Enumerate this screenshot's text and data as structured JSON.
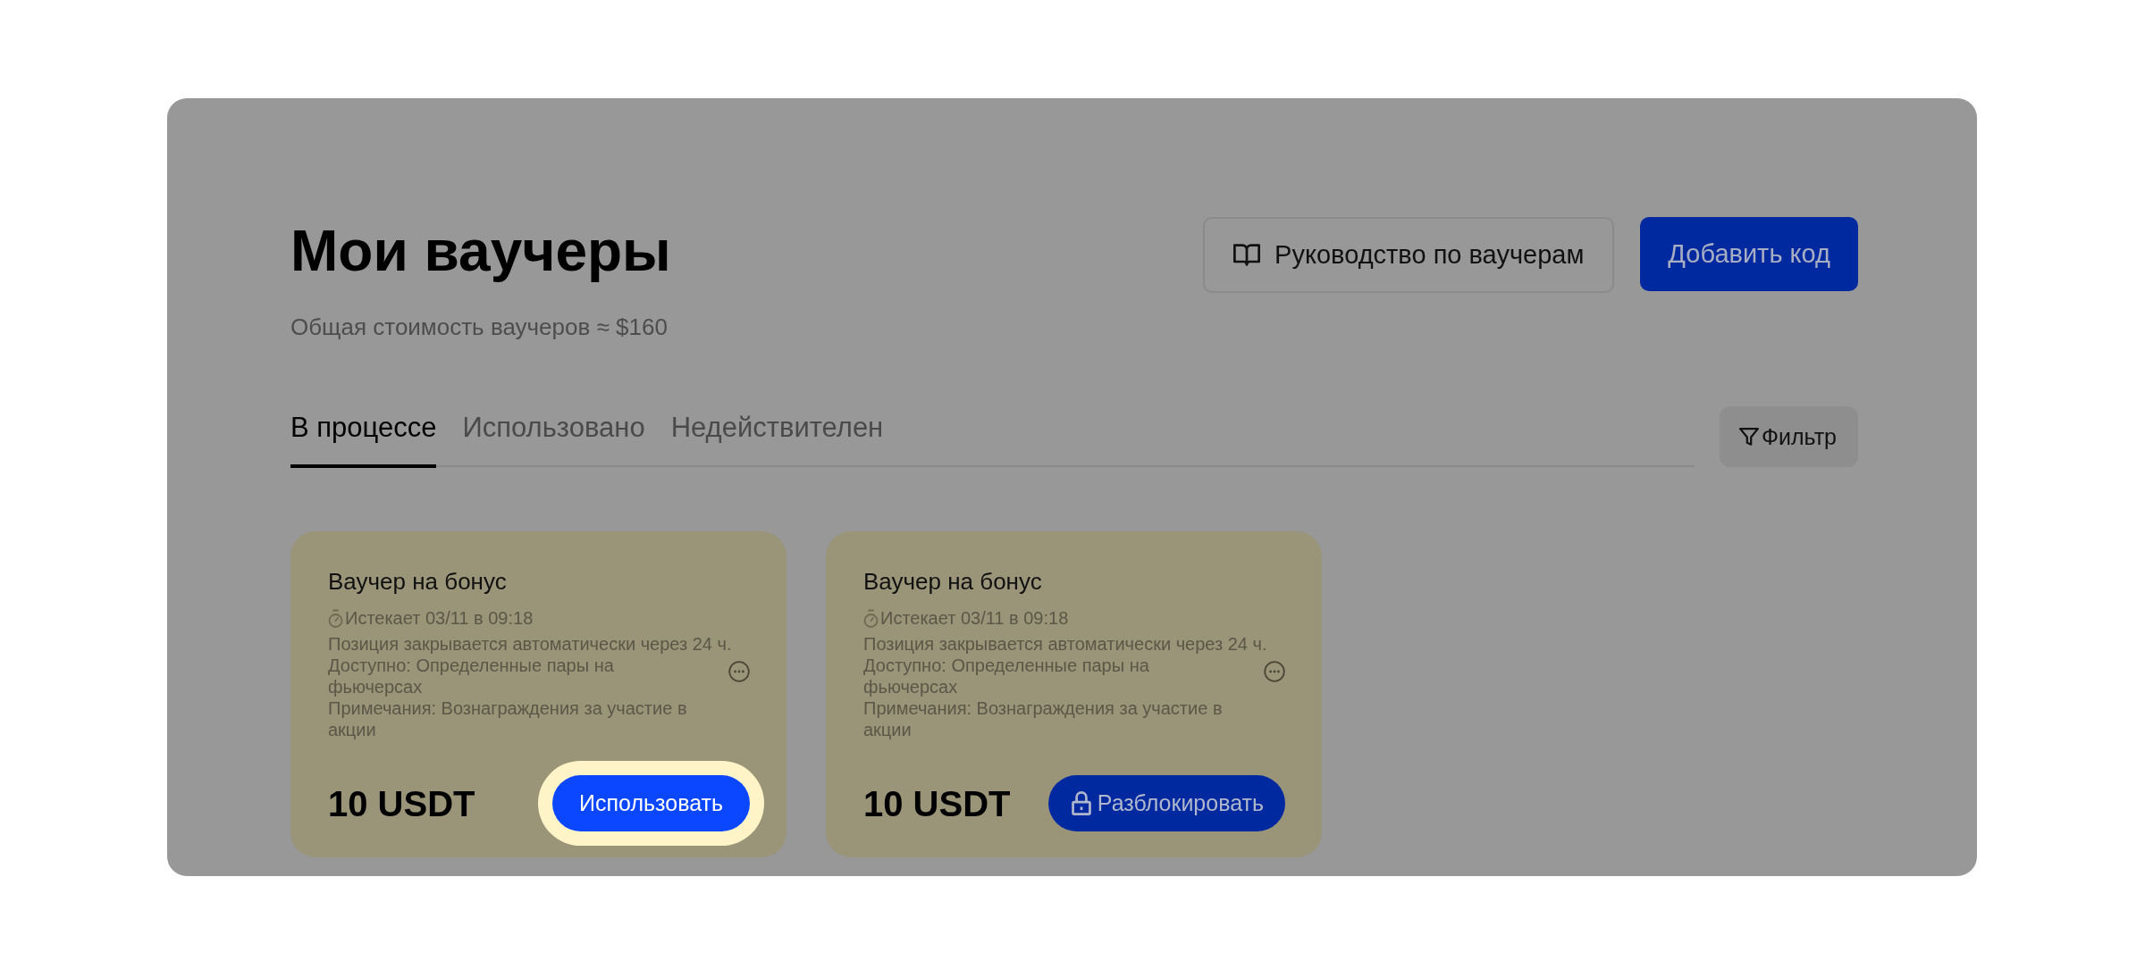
{
  "header": {
    "title": "Мои ваучеры",
    "subtitle": "Общая стоимость ваучеров ≈ $160"
  },
  "buttons": [
    {
      "kind": "guide",
      "label": "Руководство по ваучерам"
    },
    {
      "kind": "primary",
      "label": "Добавить код"
    }
  ],
  "tabs": [
    {
      "label": "В процессе",
      "selected": true
    },
    {
      "label": "Использовано",
      "selected": false
    },
    {
      "label": "Недействителен",
      "selected": false
    }
  ],
  "filter": {
    "label": "Фильтр"
  },
  "vouchers": [
    {
      "title": "Ваучер на бонус",
      "expiry": "Истекает 03/11 в 09:18",
      "note": "Позиция закрывается автоматически через 24 ч.",
      "conditions": [
        "Доступно: Определенные пары на фьючерсах",
        "Примечания: Вознаграждения за участие в акции"
      ],
      "amount": "10 USDT",
      "action": {
        "kind": "use",
        "label": "Использовать",
        "highlighted": true
      }
    },
    {
      "title": "Ваучер на бонус",
      "expiry": "Истекает 03/11 в 09:18",
      "note": "Позиция закрывается автоматически через 24 ч.",
      "conditions": [
        "Доступно: Определенные пары на фьючерсах",
        "Примечания: Вознаграждения за участие в акции"
      ],
      "amount": "10 USDT",
      "action": {
        "kind": "unlock",
        "label": "Разблокировать",
        "highlighted": false
      }
    }
  ]
}
